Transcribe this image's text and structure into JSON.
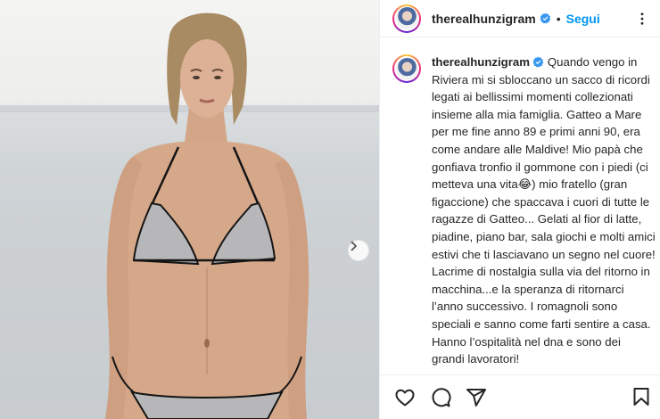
{
  "post": {
    "photo_alt": "",
    "carousel_next_label": "Next"
  },
  "header": {
    "username": "therealhunzigram",
    "separator": "•",
    "follow_label": "Segui"
  },
  "caption": {
    "username": "therealhunzigram",
    "text": "Quando vengo in Riviera mi si sbloccano un sacco di ricordi legati ai bellissimi momenti collezionati insieme alla mia famiglia. Gatteo a Mare per me fine anno 89 e primi anni 90, era come andare alle Maldive! Mio papà che gonfiava tronfio il gommone con i piedi (ci metteva una vita😂) mio fratello (gran figaccione) che spaccava i cuori di tutte le ragazze di Gatteo... Gelati al fior di latte, piadine, piano bar, sala giochi e molti amici estivi che ti lasciavano un segno nel cuore! Lacrime di nostalgia sulla via del ritorno in macchina...e la speranza di ritornarci l’anno successivo. I romagnoli sono speciali e sanno come farti sentire a casa. Hanno l’ospitalità nel dna e sono dei grandi lavoratori!"
  },
  "icons": {
    "like": "heart-icon",
    "comment": "comment-icon",
    "share": "paper-plane-icon",
    "save": "bookmark-icon",
    "more": "more-options-icon",
    "verified": "verified-badge-icon",
    "next": "chevron-right-icon"
  },
  "colors": {
    "follow": "#0095f6",
    "verified": "#3897f0",
    "text": "#262626",
    "border": "#efefef"
  }
}
